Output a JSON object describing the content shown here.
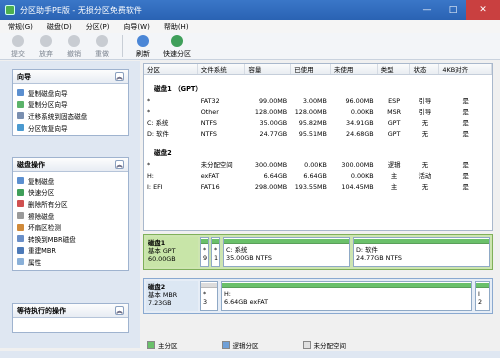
{
  "window": {
    "title": "分区助手PE版 - 无损分区免费软件",
    "controls": [
      "—",
      "□",
      "✕"
    ]
  },
  "menu": [
    "常规(G)",
    "磁盘(D)",
    "分区(P)",
    "向导(W)",
    "帮助(H)"
  ],
  "toolbar": {
    "items": [
      {
        "label": "提交",
        "icon": "submit-icon",
        "active": false
      },
      {
        "label": "放弃",
        "icon": "discard-icon",
        "active": false
      },
      {
        "label": "撤销",
        "icon": "undo-icon",
        "active": false
      },
      {
        "label": "重做",
        "icon": "redo-icon",
        "active": false
      },
      {
        "label": "刷新",
        "icon": "refresh-icon",
        "active": true
      },
      {
        "label": "快速分区",
        "icon": "quick-partition-icon",
        "active": true
      }
    ]
  },
  "wizard_panel": {
    "title": "向导",
    "items": [
      "复制磁盘向导",
      "复制分区向导",
      "迁移系统到固态磁盘",
      "分区恢复向导"
    ]
  },
  "disk_ops_panel": {
    "title": "磁盘操作",
    "items": [
      "复制磁盘",
      "快速分区",
      "删除所有分区",
      "擦除磁盘",
      "坏扇区检测",
      "转换到MBR磁盘",
      "重建MBR",
      "属性"
    ]
  },
  "pending_panel": {
    "title": "等待执行的操作"
  },
  "table": {
    "columns": [
      "分区",
      "文件系统",
      "容量",
      "已使用",
      "未使用",
      "类型",
      "状态",
      "4KB对齐"
    ],
    "disk1": {
      "title": "磁盘1 （GPT）",
      "rows": [
        [
          "*",
          "FAT32",
          "99.00MB",
          "3.00MB",
          "96.00MB",
          "ESP",
          "引导",
          "是"
        ],
        [
          "*",
          "Other",
          "128.00MB",
          "128.00MB",
          "0.00KB",
          "MSR",
          "引导",
          "是"
        ],
        [
          "C: 系统",
          "NTFS",
          "35.00GB",
          "95.82MB",
          "34.91GB",
          "GPT",
          "无",
          "是"
        ],
        [
          "D: 软件",
          "NTFS",
          "24.77GB",
          "95.51MB",
          "24.68GB",
          "GPT",
          "无",
          "是"
        ]
      ]
    },
    "disk2": {
      "title": "磁盘2",
      "rows": [
        [
          "*",
          "未分配空间",
          "300.00MB",
          "0.00KB",
          "300.00MB",
          "逻辑",
          "无",
          "是"
        ],
        [
          "H:",
          "exFAT",
          "6.64GB",
          "6.64GB",
          "0.00KB",
          "主",
          "活动",
          "是"
        ],
        [
          "I: EFI",
          "FAT16",
          "298.00MB",
          "193.55MB",
          "104.45MB",
          "主",
          "无",
          "是"
        ]
      ]
    }
  },
  "diskmap": {
    "disk1": {
      "name": "磁盘1",
      "type": "基本 GPT",
      "size": "60.00GB",
      "parts": [
        {
          "top": "*",
          "bottom": "9"
        },
        {
          "top": "*",
          "bottom": "1"
        },
        {
          "top": "C: 系统",
          "bottom": "35.00GB NTFS"
        },
        {
          "top": "D: 软件",
          "bottom": "24.77GB NTFS"
        }
      ]
    },
    "disk2": {
      "name": "磁盘2",
      "type": "基本 MBR",
      "size": "7.23GB",
      "parts": [
        {
          "top": "*",
          "bottom": "3"
        },
        {
          "top": "H:",
          "bottom": "6.64GB exFAT"
        },
        {
          "top": "I",
          "bottom": "2"
        }
      ]
    }
  },
  "legend": [
    {
      "label": "主分区",
      "color": "#6ac06a"
    },
    {
      "label": "逻辑分区",
      "color": "#6fa0d8"
    },
    {
      "label": "未分配空间",
      "color": "#e0e0e0"
    }
  ]
}
